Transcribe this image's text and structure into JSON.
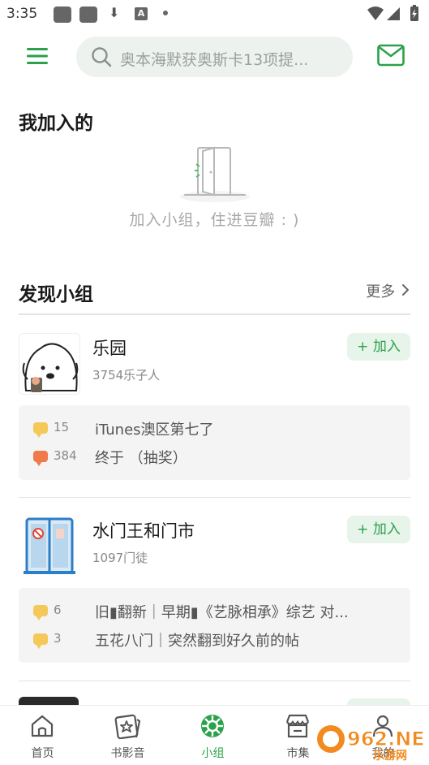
{
  "status_bar": {
    "time": "3:35"
  },
  "search": {
    "placeholder": "奥本海默获奥斯卡13项提..."
  },
  "joined": {
    "title": "我加入的",
    "empty_text": "加入小组，住进豆瓣 : )"
  },
  "discover": {
    "title": "发现小组",
    "more_label": "更多",
    "groups": [
      {
        "name": "乐园",
        "members": "3754乐子人",
        "join_label": "+ 加入",
        "posts": [
          {
            "count": "15",
            "title": "iTunes澳区第七了",
            "bubble_color": "#f5c85a"
          },
          {
            "count": "384",
            "title": "终于 （抽奖）",
            "bubble_color": "#f07a4a"
          }
        ]
      },
      {
        "name": "水门王和门市",
        "members": "1097门徒",
        "join_label": "+ 加入",
        "posts": [
          {
            "count": "6",
            "title": "旧▮翻新｜早期▮《艺脉相承》综艺 对...",
            "bubble_color": "#f5c85a"
          },
          {
            "count": "3",
            "title": "五花八门｜突然翻到好久前的帖",
            "bubble_color": "#f5c85a"
          }
        ]
      }
    ]
  },
  "bottom_nav": [
    {
      "label": "首页",
      "icon": "home-icon"
    },
    {
      "label": "书影音",
      "icon": "media-icon"
    },
    {
      "label": "小组",
      "icon": "group-icon",
      "active": true
    },
    {
      "label": "市集",
      "icon": "market-icon"
    },
    {
      "label": "我的",
      "icon": "profile-icon"
    }
  ],
  "watermark": {
    "text": "962.NET",
    "subtext": "乐游网"
  },
  "colors": {
    "accent": "#2aa14a",
    "accent_bg": "#e7f4ea"
  }
}
